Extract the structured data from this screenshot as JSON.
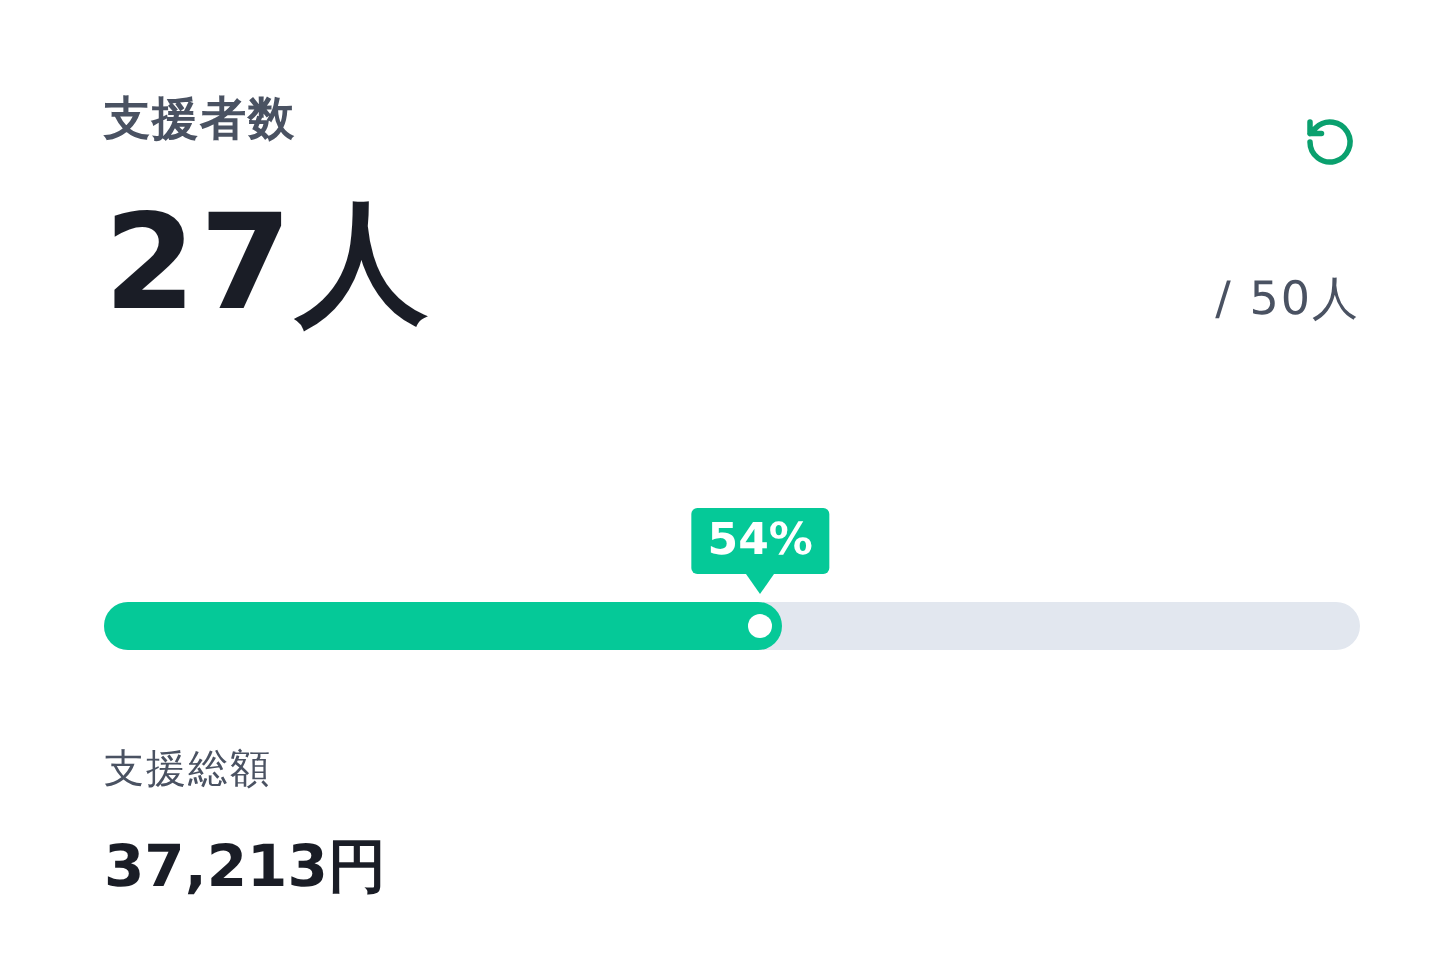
{
  "title": "支援者数",
  "count": "27人",
  "goal": "/ 50人",
  "progress": {
    "label": "54%",
    "level": 0.54
  },
  "total": {
    "label": "支援総額",
    "value": "37,213円"
  }
}
